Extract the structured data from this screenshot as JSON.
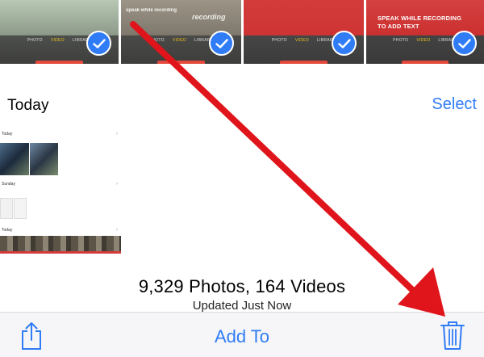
{
  "thumbnails": [
    {
      "tabs": [
        "PHOTO",
        "VIDEO",
        "LIBRARY"
      ],
      "active_tab": 1,
      "selected": true
    },
    {
      "caption_small": "speak while recording",
      "caption_big": "recording",
      "tabs": [
        "PHOTO",
        "VIDEO",
        "LIBRARY"
      ],
      "active_tab": 1,
      "selected": true
    },
    {
      "tabs": [
        "PHOTO",
        "VIDEO",
        "LIBRARY"
      ],
      "active_tab": 1,
      "selected": true
    },
    {
      "caption": "SPEAK WHILE RECORDING TO ADD TEXT",
      "tabs": [
        "PHOTO",
        "VIDEO",
        "LIBRARY"
      ],
      "active_tab": 1,
      "selected": true
    }
  ],
  "header": {
    "title": "Today",
    "select_label": "Select"
  },
  "moments_preview": {
    "days": [
      "Today",
      "Sunday",
      "Today"
    ]
  },
  "counts": {
    "summary": "9,329 Photos, 164 Videos",
    "updated": "Updated Just Now"
  },
  "toolbar": {
    "share_icon": "share-icon",
    "add_to_label": "Add To",
    "trash_icon": "trash-icon"
  },
  "colors": {
    "accent": "#2f7cf6",
    "annotation_arrow": "#e0151b"
  }
}
